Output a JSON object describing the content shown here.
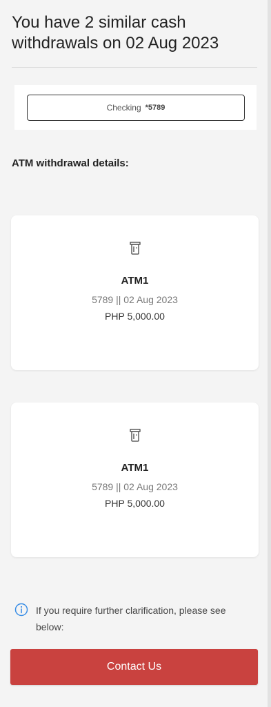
{
  "header": {
    "title": "You have 2 similar cash withdrawals on 02 Aug 2023"
  },
  "account": {
    "type": "Checking",
    "number": "*5789"
  },
  "section": {
    "heading": "ATM withdrawal details:"
  },
  "transactions": [
    {
      "name": "ATM1",
      "meta": "5789 || 02 Aug 2023",
      "amount": "PHP 5,000.00",
      "icon": "atm-card-icon"
    },
    {
      "name": "ATM1",
      "meta": "5789 || 02 Aug 2023",
      "amount": "PHP 5,000.00",
      "icon": "atm-card-icon"
    }
  ],
  "info": {
    "icon": "info-icon",
    "text": "If you require further clarification, please see below:"
  },
  "actions": {
    "contact_label": "Contact Us"
  },
  "colors": {
    "primary_button": "#c9423f",
    "info_icon": "#3a8ee6",
    "background": "#f4f4f4",
    "card": "#ffffff"
  }
}
